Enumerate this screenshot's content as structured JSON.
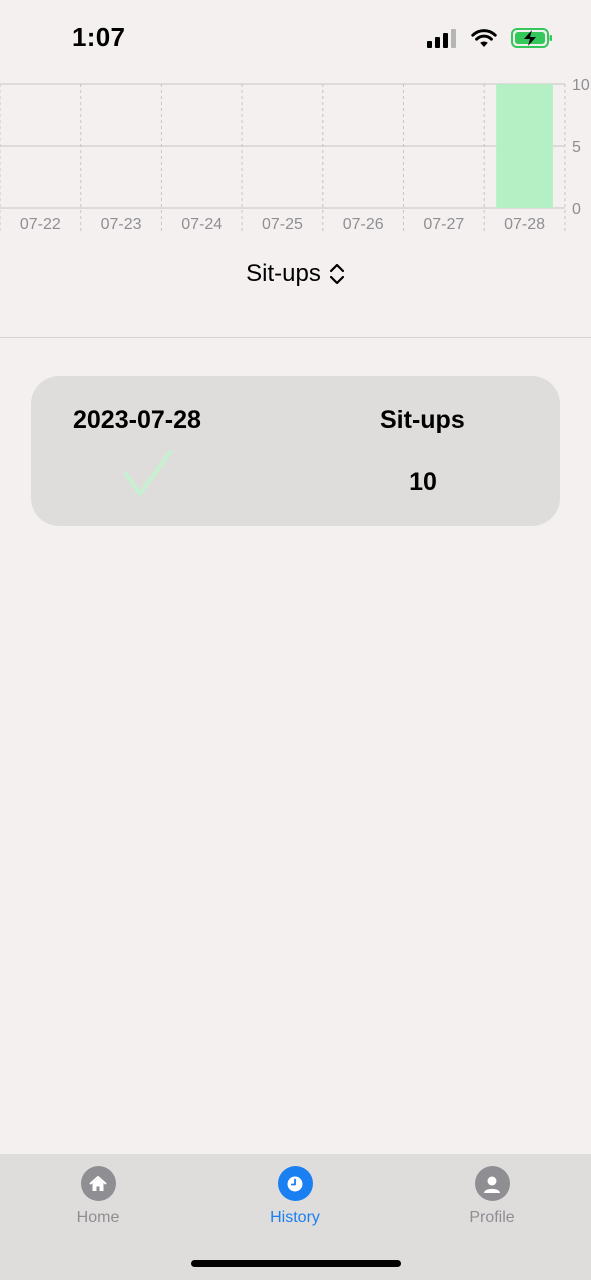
{
  "status": {
    "time": "1:07"
  },
  "chart_data": {
    "type": "bar",
    "categories": [
      "07-22",
      "07-23",
      "07-24",
      "07-25",
      "07-26",
      "07-27",
      "07-28"
    ],
    "values": [
      0,
      0,
      0,
      0,
      0,
      0,
      10
    ],
    "y_ticks": [
      "10",
      "5",
      "0"
    ],
    "ylim": [
      0,
      10
    ],
    "grid": true,
    "bar_color": "#b5efc4"
  },
  "selector": {
    "label": "Sit-ups"
  },
  "entries": [
    {
      "date": "2023-07-28",
      "exercise": "Sit-ups",
      "count": "10",
      "completed": true
    }
  ],
  "tabs": [
    {
      "label": "Home",
      "icon": "house-icon",
      "active": false
    },
    {
      "label": "History",
      "icon": "clock-icon",
      "active": true
    },
    {
      "label": "Profile",
      "icon": "person-icon",
      "active": false
    }
  ],
  "colors": {
    "accent": "#1a7ff0",
    "inactive": "#8e8e93",
    "check": "#c6f0cf"
  }
}
